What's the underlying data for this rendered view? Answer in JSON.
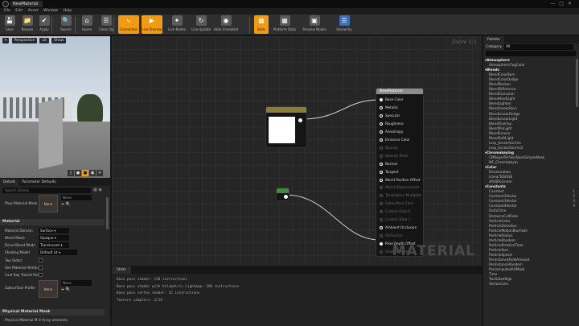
{
  "window": {
    "asset_tab": "NewMaterial"
  },
  "menu": [
    "File",
    "Edit",
    "Asset",
    "Window",
    "Help"
  ],
  "toolbar": [
    {
      "label": "Save",
      "icon": "save-icon",
      "state": "normal"
    },
    {
      "label": "Browse",
      "icon": "browse-icon",
      "state": "normal"
    },
    {
      "label": "Apply",
      "icon": "apply-icon",
      "state": "normal"
    },
    {
      "label": "Search",
      "icon": "search-icon",
      "state": "normal"
    },
    {
      "label": "Home",
      "icon": "home-icon",
      "state": "normal"
    },
    {
      "label": "Clean Up",
      "icon": "clean-up-icon",
      "state": "normal"
    },
    {
      "label": "Connectors",
      "icon": "connectors-icon",
      "state": "active"
    },
    {
      "label": "Live Preview",
      "icon": "live-preview-icon",
      "state": "active"
    },
    {
      "label": "Live Nodes",
      "icon": "live-nodes-icon",
      "state": "normal"
    },
    {
      "label": "Live Update",
      "icon": "live-update-icon",
      "state": "normal"
    },
    {
      "label": "Hide Unrelated",
      "icon": "hide-unrelated-icon",
      "state": "normal"
    },
    {
      "label": "Stats",
      "icon": "stats-icon",
      "state": "active"
    },
    {
      "label": "Platform Stats",
      "icon": "platform-stats-icon",
      "state": "normal"
    },
    {
      "label": "Preview Nodes",
      "icon": "preview-nodes-icon",
      "state": "normal"
    },
    {
      "label": "Hierarchy",
      "icon": "hierarchy-icon",
      "state": "normal"
    }
  ],
  "viewport": {
    "perspective_label": "Perspective",
    "lit_label": "Lit",
    "show_label": "Show"
  },
  "details": {
    "tab_details": "Details",
    "tab_params": "Parameter Defaults",
    "search_placeholder": "Search Details",
    "physical_material_label": "Phys Material Mask",
    "physical_material_thumb": "None",
    "physical_material_value": "None",
    "section_material": "Material",
    "rows": [
      {
        "label": "Material Domain",
        "value": "Surface"
      },
      {
        "label": "Blend Mode",
        "value": "Opaque"
      },
      {
        "label": "Decal Blend Mode",
        "value": "Translucent"
      },
      {
        "label": "Shading Model",
        "value": "Default Lit"
      }
    ],
    "two_sided": "Two Sided",
    "use_attributes": "Use Material Attribut",
    "cast_ray": "Cast Ray Traced Sha",
    "subsurface_label": "Subsurface Profile",
    "subsurface_thumb": "None",
    "subsurface_value": "None",
    "section_phys_mask": "Physical Material Mask",
    "phys_mask_row_label": "Physical Material M",
    "phys_mask_row_value": "0 Array elements"
  },
  "graph": {
    "zoom": "Zoom 1:1",
    "watermark": "MATERIAL",
    "texture_node_title": "",
    "material_node_title": "NewMaterial",
    "pins": [
      {
        "label": "Base Color",
        "state": "connected"
      },
      {
        "label": "Metallic",
        "state": "normal"
      },
      {
        "label": "Specular",
        "state": "normal"
      },
      {
        "label": "Roughness",
        "state": "normal"
      },
      {
        "label": "Anisotropy",
        "state": "normal"
      },
      {
        "label": "Emissive Color",
        "state": "normal"
      },
      {
        "label": "Opacity",
        "state": "dim"
      },
      {
        "label": "Opacity Mask",
        "state": "dim"
      },
      {
        "label": "Normal",
        "state": "normal"
      },
      {
        "label": "Tangent",
        "state": "normal"
      },
      {
        "label": "World Position Offset",
        "state": "normal"
      },
      {
        "label": "World Displacement",
        "state": "dim"
      },
      {
        "label": "Tessellation Multiplier",
        "state": "dim"
      },
      {
        "label": "Subsurface Color",
        "state": "dim"
      },
      {
        "label": "Custom Data 0",
        "state": "dim"
      },
      {
        "label": "Custom Data 1",
        "state": "dim"
      },
      {
        "label": "Ambient Occlusion",
        "state": "normal"
      },
      {
        "label": "Refraction",
        "state": "dim"
      },
      {
        "label": "Pixel Depth Offset",
        "state": "connected"
      },
      {
        "label": "Shading Model",
        "state": "dim"
      }
    ]
  },
  "stats": {
    "tab": "Stats",
    "lines": [
      "Base pass shader: 118 instructions",
      "Base pass shader with Volumetric Lightmap: 190 instructions",
      "Base pass vertex shader: 42 instructions",
      "Texture samplers: 2/16"
    ]
  },
  "palette": {
    "tab": "Palette",
    "category_label": "Category",
    "category_value": "All",
    "items": [
      {
        "text": "Atmosphere",
        "type": "cat"
      },
      {
        "text": "AtmosphericFogColor",
        "type": "it"
      },
      {
        "text": "Blends",
        "type": "cat"
      },
      {
        "text": "BlendColorBurn",
        "type": "it"
      },
      {
        "text": "BlendColorDodge",
        "type": "it"
      },
      {
        "text": "BlendDarken",
        "type": "it"
      },
      {
        "text": "BlendDifference",
        "type": "it"
      },
      {
        "text": "BlendExclusion",
        "type": "it"
      },
      {
        "text": "BlendHardLight",
        "type": "it"
      },
      {
        "text": "BlendLighten",
        "type": "it"
      },
      {
        "text": "BlendLinearBurn",
        "type": "it"
      },
      {
        "text": "BlendLinearDodge",
        "type": "it"
      },
      {
        "text": "BlendLinearLight",
        "type": "it"
      },
      {
        "text": "BlendOverlay",
        "type": "it"
      },
      {
        "text": "BlendPinLight",
        "type": "it"
      },
      {
        "text": "BlendScreen",
        "type": "it"
      },
      {
        "text": "BlendSoftLight",
        "type": "it"
      },
      {
        "text": "Lerp_ScratchGrime",
        "type": "it"
      },
      {
        "text": "Lerp_ScratchGrime2",
        "type": "it"
      },
      {
        "text": "Chromakeying",
        "type": "cat"
      },
      {
        "text": "CMKeyerPerSkinBaseSimpleMask",
        "type": "it"
      },
      {
        "text": "MF_ChromakeyIn",
        "type": "it"
      },
      {
        "text": "Color",
        "type": "cat"
      },
      {
        "text": "Desaturation",
        "type": "it"
      },
      {
        "text": "LinearToSRGB",
        "type": "it"
      },
      {
        "text": "sRGBToLinear",
        "type": "it"
      },
      {
        "text": "Constants",
        "type": "cat"
      },
      {
        "text": "Constant",
        "type": "it",
        "hotkey": "1"
      },
      {
        "text": "Constant2Vector",
        "type": "it",
        "hotkey": "2"
      },
      {
        "text": "Constant3Vector",
        "type": "it",
        "hotkey": "3"
      },
      {
        "text": "Constant4Vector",
        "type": "it",
        "hotkey": "4"
      },
      {
        "text": "DeltaTime",
        "type": "it"
      },
      {
        "text": "DistanceCullFade",
        "type": "it"
      },
      {
        "text": "ParticleColor",
        "type": "it"
      },
      {
        "text": "ParticleDirection",
        "type": "it"
      },
      {
        "text": "ParticleMotionBlurFade",
        "type": "it"
      },
      {
        "text": "ParticleRadius",
        "type": "it"
      },
      {
        "text": "ParticleRandom",
        "type": "it"
      },
      {
        "text": "ParticleRelativeTime",
        "type": "it"
      },
      {
        "text": "ParticleSize",
        "type": "it"
      },
      {
        "text": "ParticleSpeed",
        "type": "it"
      },
      {
        "text": "PerInstanceFadeAmount",
        "type": "it"
      },
      {
        "text": "PerInstanceRandom",
        "type": "it"
      },
      {
        "text": "PrecomputedAOMask",
        "type": "it"
      },
      {
        "text": "Time",
        "type": "it"
      },
      {
        "text": "TwoSidedSign",
        "type": "it"
      },
      {
        "text": "VertexColor",
        "type": "it"
      }
    ]
  },
  "colors": {
    "accent": "#f19a12",
    "texture_node": "#8a7c39",
    "constant_node": "#3f8a3f",
    "material_node": "#8c8c8c"
  }
}
